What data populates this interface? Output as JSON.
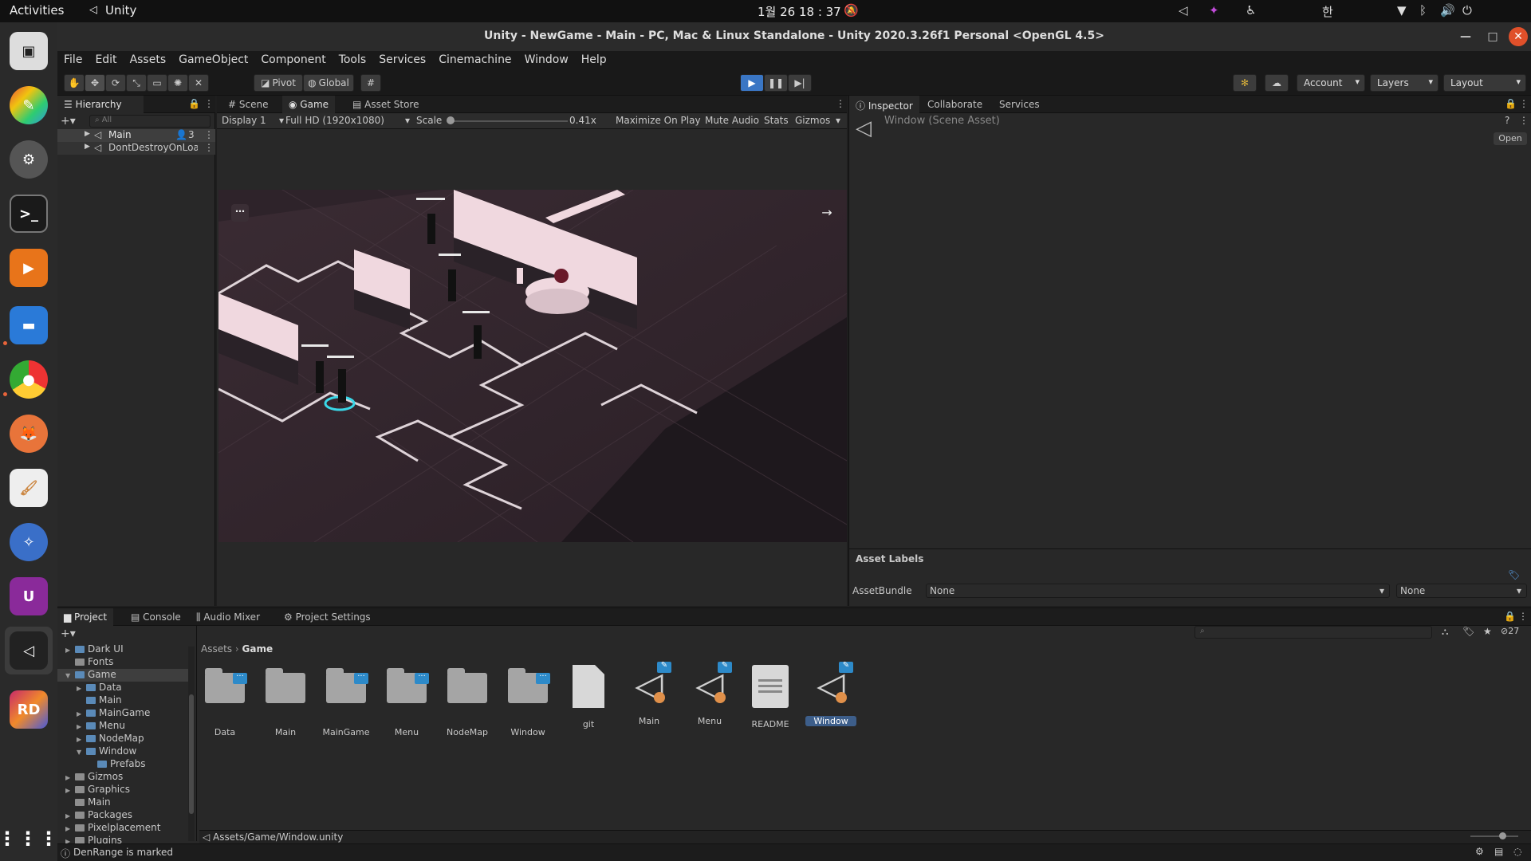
{
  "gnome": {
    "activities": "Activities",
    "app_name": "Unity",
    "clock": "1월 26  18 : 37",
    "ime": "한"
  },
  "window": {
    "title": "Unity - NewGame - Main - PC, Mac & Linux Standalone - Unity 2020.3.26f1 Personal <OpenGL 4.5>"
  },
  "menu": [
    "File",
    "Edit",
    "Assets",
    "GameObject",
    "Component",
    "Tools",
    "Services",
    "Cinemachine",
    "Window",
    "Help"
  ],
  "toolbar": {
    "pivot": "Pivot",
    "global": "Global",
    "account": "Account",
    "layers": "Layers",
    "layout": "Layout"
  },
  "hierarchy": {
    "tab": "Hierarchy",
    "search_placeholder": "All",
    "items": [
      {
        "label": "Main",
        "count": "3"
      },
      {
        "label": "DontDestroyOnLoad"
      }
    ]
  },
  "center_tabs": [
    "Scene",
    "Game",
    "Asset Store"
  ],
  "game_bar": {
    "display": "Display 1",
    "resolution": "Full HD (1920x1080)",
    "scale_label": "Scale",
    "scale_value": "0.41x",
    "maximize": "Maximize On Play",
    "mute": "Mute Audio",
    "stats": "Stats",
    "gizmos": "Gizmos"
  },
  "inspector": {
    "tabs": [
      "Inspector",
      "Collaborate",
      "Services"
    ],
    "object": "Window (Scene Asset)",
    "open": "Open",
    "asset_labels": "Asset Labels",
    "assetbundle_label": "AssetBundle",
    "assetbundle_value": "None",
    "variant_value": "None"
  },
  "bottom_tabs": [
    "Project",
    "Console",
    "Audio Mixer",
    "Project Settings"
  ],
  "project": {
    "tree": [
      {
        "label": "Dark UI",
        "indent": 0,
        "arrow": "▶"
      },
      {
        "label": "Fonts",
        "indent": 0,
        "arrow": ""
      },
      {
        "label": "Game",
        "indent": 0,
        "arrow": "▼",
        "selected": true
      },
      {
        "label": "Data",
        "indent": 1,
        "arrow": "▶"
      },
      {
        "label": "Main",
        "indent": 1,
        "arrow": ""
      },
      {
        "label": "MainGame",
        "indent": 1,
        "arrow": "▶"
      },
      {
        "label": "Menu",
        "indent": 1,
        "arrow": "▶"
      },
      {
        "label": "NodeMap",
        "indent": 1,
        "arrow": "▶"
      },
      {
        "label": "Window",
        "indent": 1,
        "arrow": "▼"
      },
      {
        "label": "Prefabs",
        "indent": 2,
        "arrow": ""
      },
      {
        "label": "Gizmos",
        "indent": 0,
        "arrow": "▶"
      },
      {
        "label": "Graphics",
        "indent": 0,
        "arrow": "▶"
      },
      {
        "label": "Main",
        "indent": 0,
        "arrow": ""
      },
      {
        "label": "Packages",
        "indent": 0,
        "arrow": "▶"
      },
      {
        "label": "Pixelplacement",
        "indent": 0,
        "arrow": "▶"
      },
      {
        "label": "Plugins",
        "indent": 0,
        "arrow": "▶"
      }
    ],
    "breadcrumb": [
      "Assets",
      "Game"
    ],
    "hidden_count": "27",
    "assets": [
      {
        "label": "Data",
        "kind": "folder",
        "badge": true
      },
      {
        "label": "Main",
        "kind": "folder",
        "badge": false
      },
      {
        "label": "MainGame",
        "kind": "folder",
        "badge": true
      },
      {
        "label": "Menu",
        "kind": "folder",
        "badge": true
      },
      {
        "label": "NodeMap",
        "kind": "folder",
        "badge": false
      },
      {
        "label": "Window",
        "kind": "folder",
        "badge": true
      },
      {
        "label": "git",
        "kind": "file",
        "badge": false
      },
      {
        "label": "Main",
        "kind": "scene",
        "badge": true
      },
      {
        "label": "Menu",
        "kind": "scene",
        "badge": true
      },
      {
        "label": "README",
        "kind": "text",
        "badge": false
      },
      {
        "label": "Window",
        "kind": "scene",
        "badge": true,
        "selected": true
      }
    ],
    "path": "Assets/Game/Window.unity"
  },
  "status": "DenRange is marked"
}
